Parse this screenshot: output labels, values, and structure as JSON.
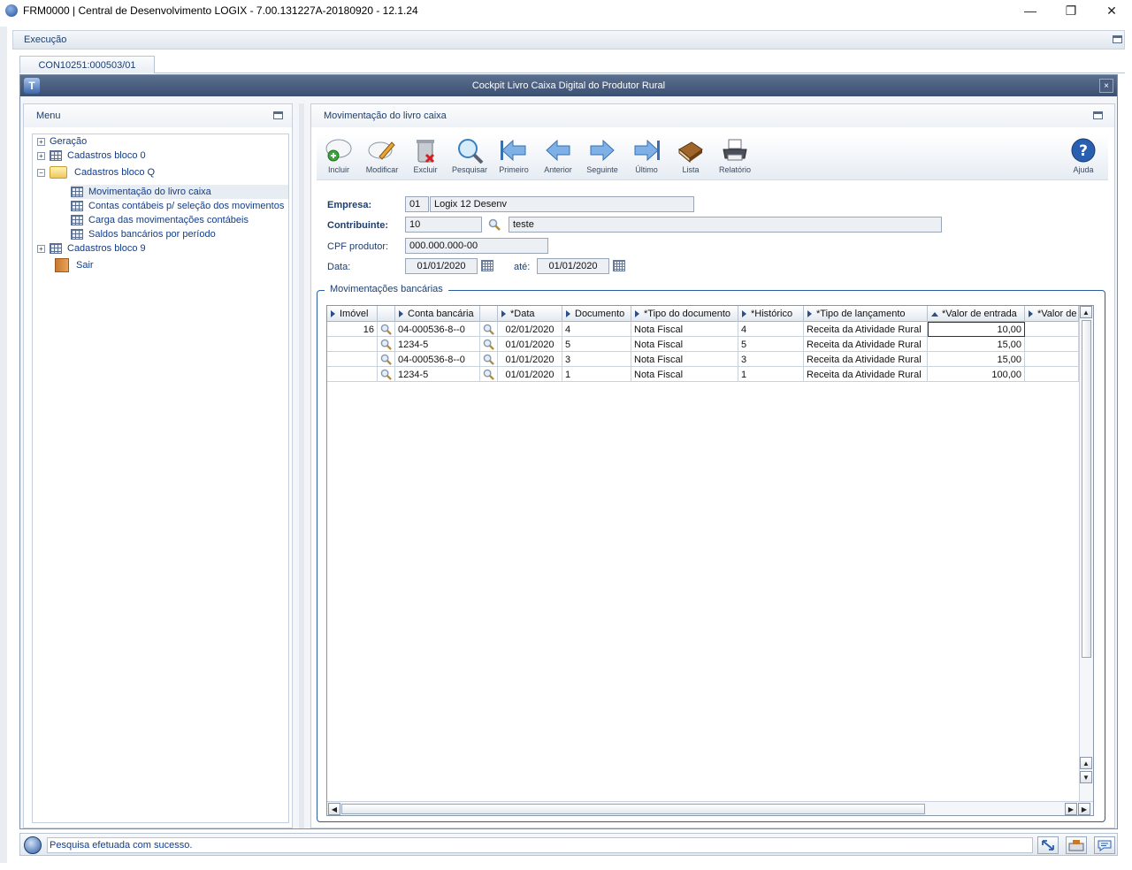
{
  "window": {
    "title": "FRM0000 | Central de Desenvolvimento LOGIX  -  7.00.131227A-20180920  -  12.1.24",
    "min": "—",
    "max": "❐",
    "close": "✕"
  },
  "exec_bar": {
    "label": "Execução"
  },
  "tab": {
    "label": "CON10251:000503/01"
  },
  "frame": {
    "logo": "T",
    "title": "Cockpit Livro Caixa Digital do Produtor Rural",
    "close": "×"
  },
  "menu": {
    "title": "Menu",
    "items": [
      {
        "label": "Geração"
      },
      {
        "label": "Cadastros bloco 0"
      },
      {
        "label": "Cadastros bloco Q"
      },
      {
        "label": "Movimentação do livro caixa"
      },
      {
        "label": "Contas contábeis p/ seleção dos movimentos"
      },
      {
        "label": "Carga das movimentações contábeis"
      },
      {
        "label": "Saldos bancários por período"
      },
      {
        "label": "Cadastros bloco 9"
      },
      {
        "label": "Sair"
      }
    ],
    "expanders": {
      "plus": "+",
      "minus": "−"
    }
  },
  "content": {
    "title": "Movimentação do livro caixa",
    "toolbar": {
      "incluir": "Incluir",
      "modificar": "Modificar",
      "excluir": "Excluir",
      "pesquisar": "Pesquisar",
      "primeiro": "Primeiro",
      "anterior": "Anterior",
      "seguinte": "Seguinte",
      "ultimo": "Último",
      "lista": "Lista",
      "relatorio": "Relatório",
      "ajuda": "Ajuda"
    },
    "form": {
      "empresa_label": "Empresa:",
      "empresa_code": "01",
      "empresa_name": "Logix 12 Desenv",
      "contribuinte_label": "Contribuinte:",
      "contribuinte_code": "10",
      "contribuinte_name": "teste",
      "cpf_label": "CPF produtor:",
      "cpf_value": "000.000.000-00",
      "data_label": "Data:",
      "data_from": "01/01/2020",
      "ate_label": "até:",
      "data_to": "01/01/2020"
    },
    "group": {
      "title": "Movimentações bancárias",
      "columns": [
        "Imóvel",
        "Conta bancária",
        "*Data",
        "Documento",
        "*Tipo do documento",
        "*Histórico",
        "*Tipo de lançamento",
        "*Valor de entrada",
        "*Valor de"
      ],
      "rows": [
        {
          "imovel": "16",
          "conta": "04-000536-8--0",
          "data": "02/01/2020",
          "documento": "4",
          "tipo_doc": "Nota Fiscal",
          "historico": "4",
          "tipo_lanc": "Receita da Atividade Rural",
          "valor": "10,00"
        },
        {
          "imovel": "",
          "conta": "1234-5",
          "data": "01/01/2020",
          "documento": "5",
          "tipo_doc": "Nota Fiscal",
          "historico": "5",
          "tipo_lanc": "Receita da Atividade Rural",
          "valor": "15,00"
        },
        {
          "imovel": "",
          "conta": "04-000536-8--0",
          "data": "01/01/2020",
          "documento": "3",
          "tipo_doc": "Nota Fiscal",
          "historico": "3",
          "tipo_lanc": "Receita da Atividade Rural",
          "valor": "15,00"
        },
        {
          "imovel": "",
          "conta": "1234-5",
          "data": "01/01/2020",
          "documento": "1",
          "tipo_doc": "Nota Fiscal",
          "historico": "1",
          "tipo_lanc": "Receita da Atividade Rural",
          "valor": "100,00"
        }
      ],
      "scroll": {
        "up": "▲",
        "down": "▼",
        "left": "◀",
        "right": "▶"
      }
    }
  },
  "status": {
    "message": "Pesquisa efetuada com sucesso."
  },
  "colors": {
    "accent": "#1d3e6e",
    "frame_title": "#3b4f72",
    "link": "#123d87"
  }
}
